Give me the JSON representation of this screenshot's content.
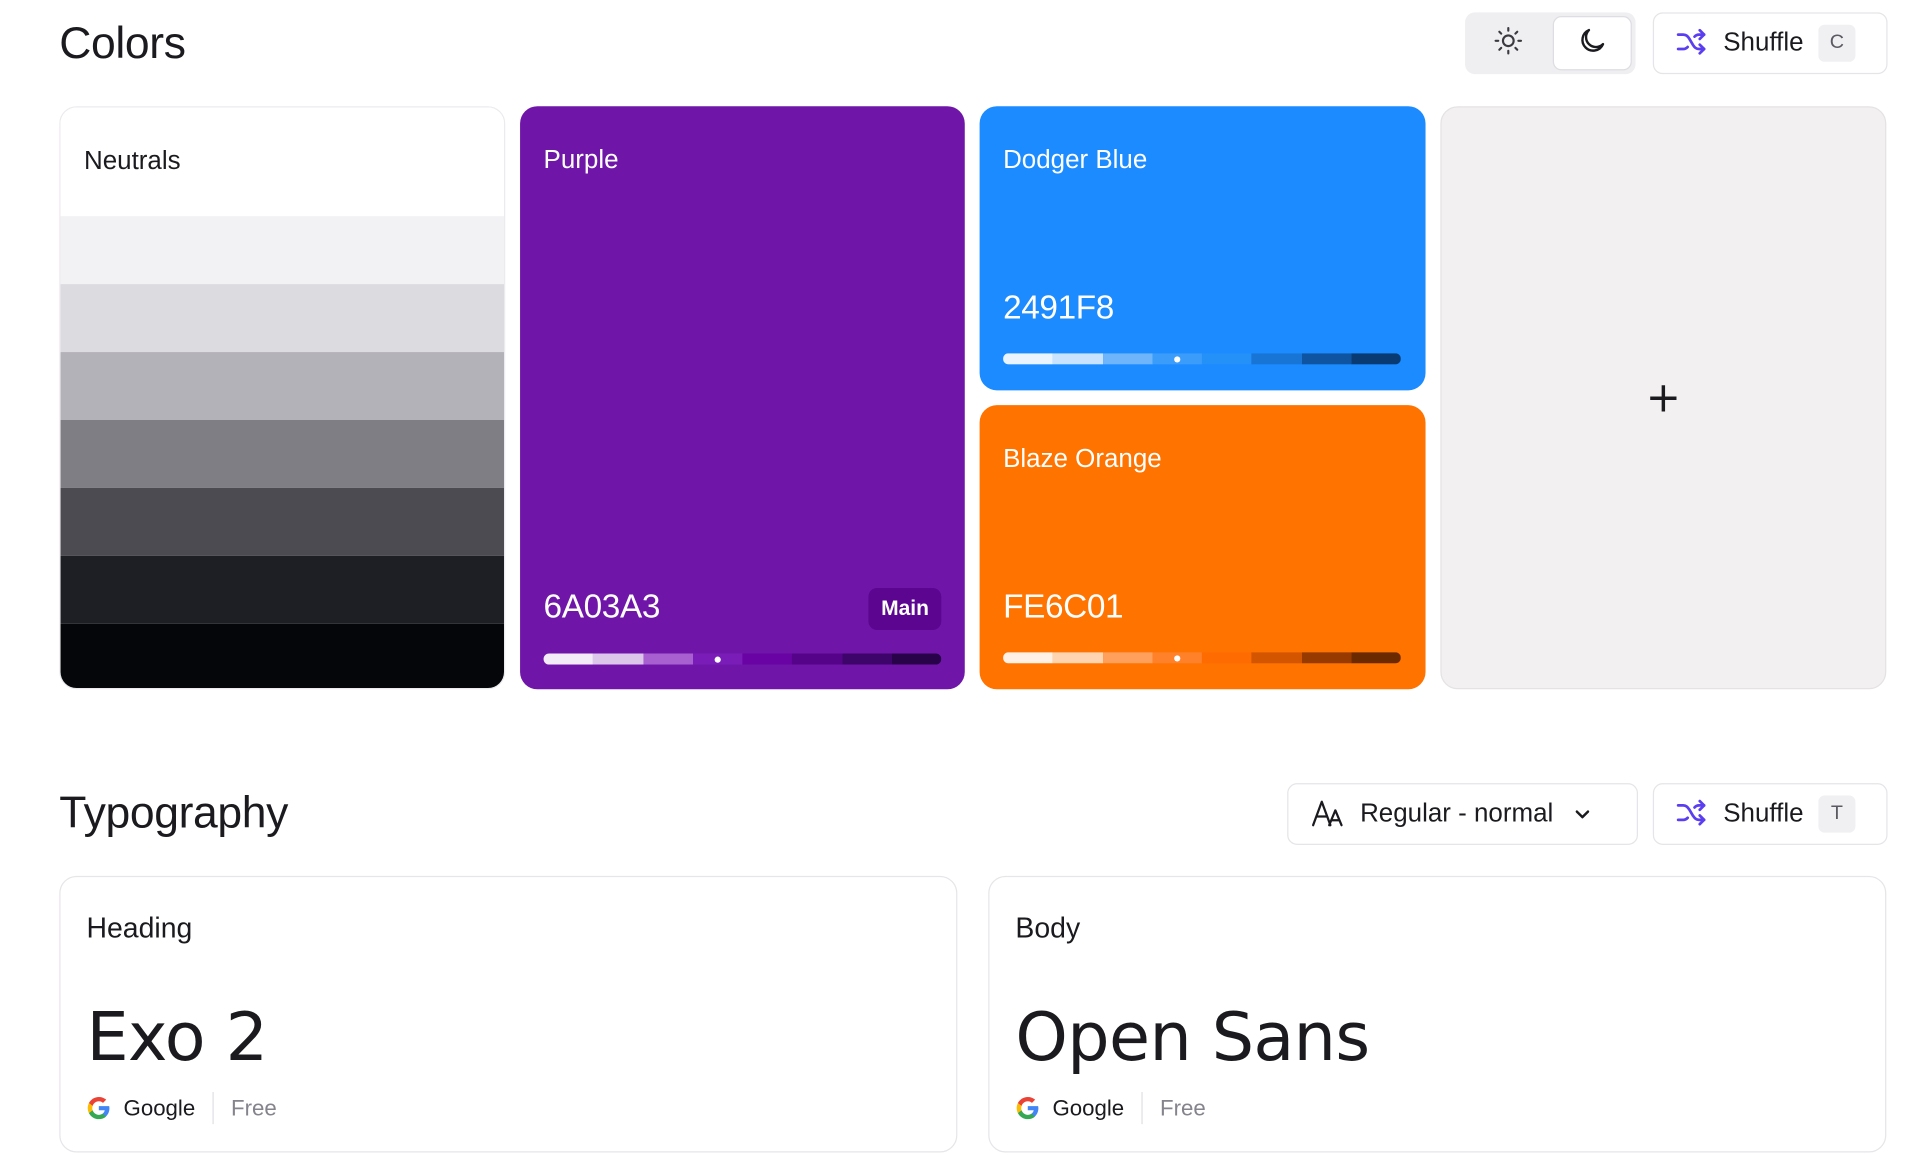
{
  "colors_section": {
    "title": "Colors",
    "theme_toggle": {
      "light_icon": "sun-icon",
      "dark_icon": "moon-icon",
      "active": "dark"
    },
    "shuffle": {
      "label": "Shuffle",
      "shortcut": "C"
    }
  },
  "palette": {
    "neutrals": {
      "name": "Neutrals",
      "shades": [
        "#ffffff",
        "#f2f1f4",
        "#dcdbdf",
        "#b3b2b8",
        "#7f7e85",
        "#4b4b51",
        "#1e1f25",
        "#04060a"
      ]
    },
    "purple": {
      "name": "Purple",
      "hex": "6A03A3",
      "badge": "Main",
      "color": "#6f16a9",
      "shades": [
        "#f3ebf7",
        "#dcc6ea",
        "#a860d0",
        "#7a1db8",
        "#6a03a3",
        "#55048a",
        "#3d046a",
        "#28034a"
      ]
    },
    "dodger_blue": {
      "name": "Dodger Blue",
      "hex": "2491F8",
      "color": "#1b8bff",
      "shades": [
        "#eaf4ff",
        "#c9e3fe",
        "#6eb5fb",
        "#3c9cfa",
        "#2491f8",
        "#1875d6",
        "#0f54a0",
        "#0a3a72"
      ]
    },
    "blaze_orange": {
      "name": "Blaze Orange",
      "hex": "FE6C01",
      "color": "#ff7300",
      "shades": [
        "#fff1e5",
        "#ffd4b0",
        "#ffa05c",
        "#ff8129",
        "#fe6c01",
        "#d45500",
        "#963a00",
        "#6b2900"
      ]
    },
    "add_label": "+"
  },
  "typography_section": {
    "title": "Typography",
    "weight_select": {
      "icon": "font-size-icon",
      "value": "Regular - normal"
    },
    "shuffle": {
      "label": "Shuffle",
      "shortcut": "T"
    }
  },
  "fonts": {
    "heading": {
      "role": "Heading",
      "name": "Exo 2",
      "provider": "Google",
      "license": "Free"
    },
    "body": {
      "role": "Body",
      "name": "Open Sans",
      "provider": "Google",
      "license": "Free"
    }
  }
}
